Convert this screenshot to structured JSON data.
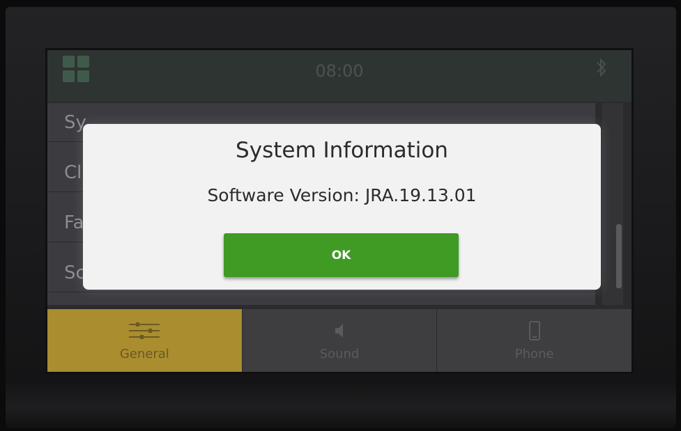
{
  "status_bar": {
    "apps_icon": "grid-apps-icon",
    "time": "08:00",
    "bluetooth_icon": "bluetooth-icon"
  },
  "settings_list": {
    "items": [
      {
        "label": "Sy"
      },
      {
        "label": "Cl"
      },
      {
        "label": "Fa"
      },
      {
        "label": "Sc"
      }
    ]
  },
  "dialog": {
    "title": "System Information",
    "body": "Software Version: JRA.19.13.01",
    "ok_label": "OK",
    "ok_color": "#3f9b24"
  },
  "tabs": [
    {
      "label": "General",
      "icon": "sliders-icon",
      "active": true
    },
    {
      "label": "Sound",
      "icon": "speaker-icon",
      "active": false
    },
    {
      "label": "Phone",
      "icon": "phone-icon",
      "active": false
    }
  ],
  "colors": {
    "active_tab": "#a98d2f",
    "dialog_background": "#f2f2f2"
  }
}
